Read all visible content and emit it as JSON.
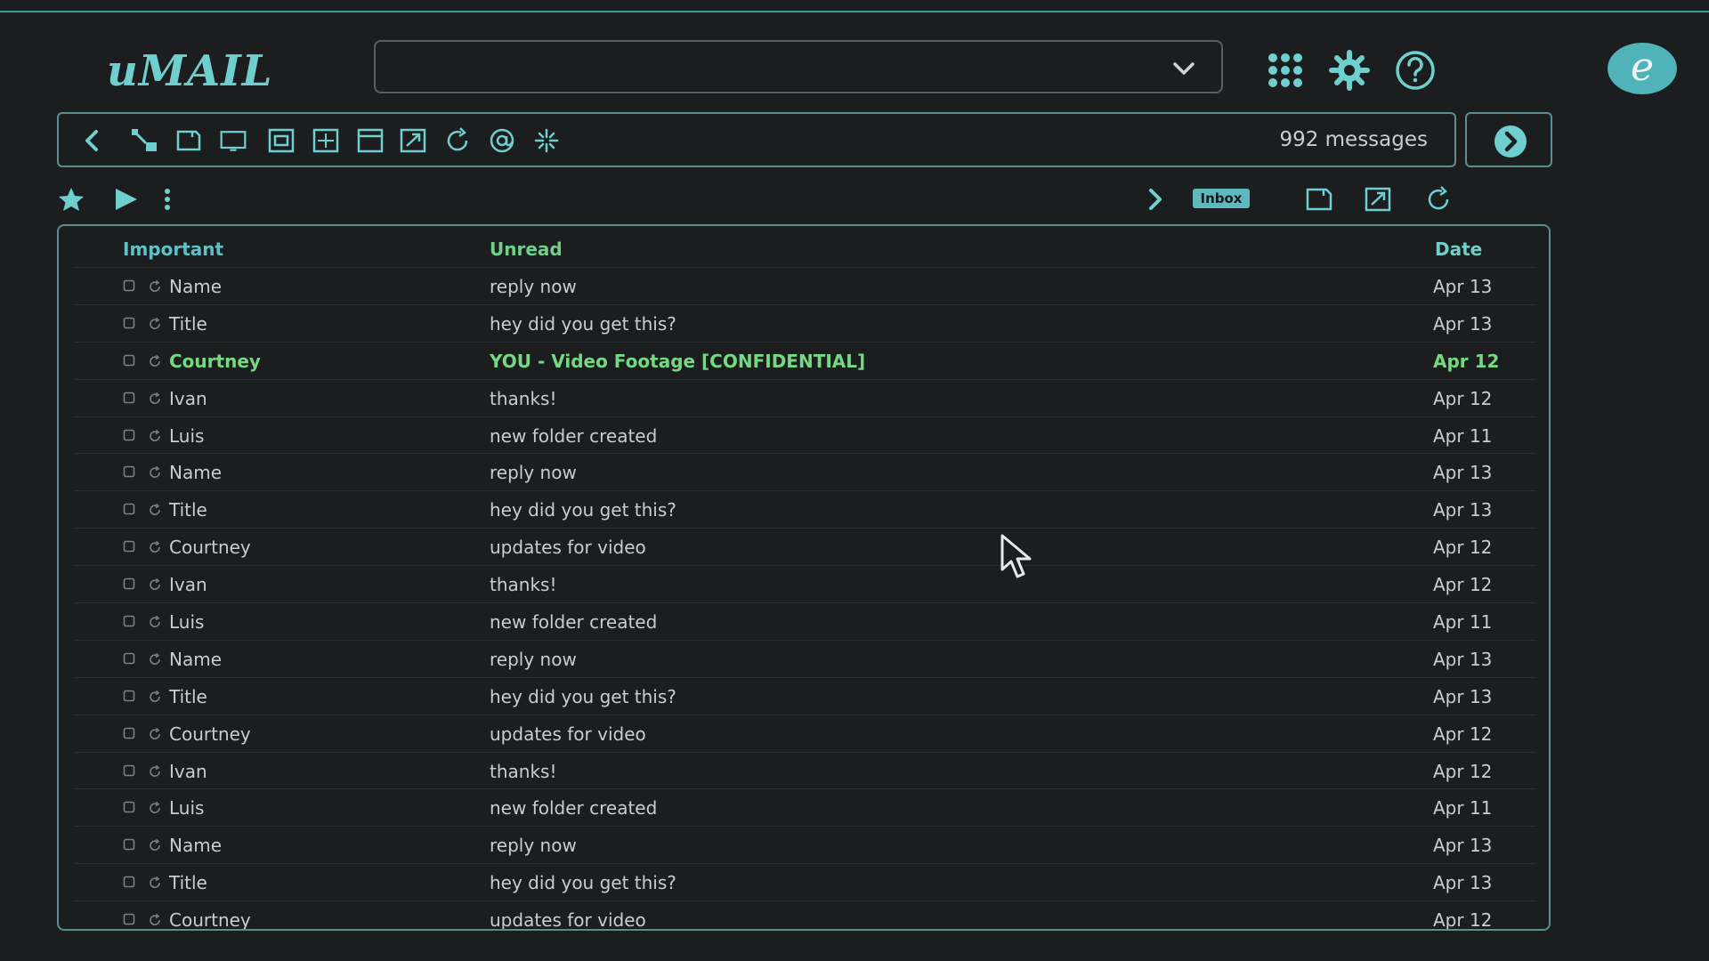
{
  "app": {
    "logo": "uMAIL"
  },
  "colors": {
    "accent": "#5fc0c6",
    "highlight": "#74d982",
    "background": "#1c1d1f"
  },
  "header": {
    "search": {
      "value": "",
      "placeholder": ""
    },
    "icons": [
      "apps-grid-icon",
      "gear-icon",
      "help-icon"
    ],
    "avatar_letter": "e"
  },
  "toolbar": {
    "icons": [
      "back-icon",
      "move-icon",
      "archive-icon",
      "window-icon",
      "frame-icon",
      "grid-icon",
      "layout-icon",
      "open-external-icon",
      "refresh-icon",
      "mention-icon",
      "sparkle-icon"
    ],
    "message_count": "992 messages",
    "next_icon": "chevron-right-circle-icon"
  },
  "subbar": {
    "folder_badge": "Inbox"
  },
  "table": {
    "columns": {
      "important": "Important",
      "unread": "Unread",
      "date": "Date"
    },
    "rows": [
      {
        "sender": "Name",
        "subject": "reply now",
        "date": "Apr 13"
      },
      {
        "sender": "Title",
        "subject": "hey did you get this?",
        "date": "Apr 13"
      },
      {
        "sender": "Courtney",
        "subject": "YOU - Video Footage [CONFIDENTIAL]",
        "date": "Apr 12",
        "highlight": true
      },
      {
        "sender": "Ivan",
        "subject": "thanks!",
        "date": "Apr 12"
      },
      {
        "sender": "Luis",
        "subject": "new folder created",
        "date": "Apr 11"
      },
      {
        "sender": "Name",
        "subject": "reply now",
        "date": "Apr 13"
      },
      {
        "sender": "Title",
        "subject": "hey did you get this?",
        "date": "Apr 13"
      },
      {
        "sender": "Courtney",
        "subject": "updates for video",
        "date": "Apr 12"
      },
      {
        "sender": "Ivan",
        "subject": "thanks!",
        "date": "Apr 12"
      },
      {
        "sender": "Luis",
        "subject": "new folder created",
        "date": "Apr 11"
      },
      {
        "sender": "Name",
        "subject": "reply now",
        "date": "Apr 13"
      },
      {
        "sender": "Title",
        "subject": "hey did you get this?",
        "date": "Apr 13"
      },
      {
        "sender": "Courtney",
        "subject": "updates for video",
        "date": "Apr 12"
      },
      {
        "sender": "Ivan",
        "subject": "thanks!",
        "date": "Apr 12"
      },
      {
        "sender": "Luis",
        "subject": "new folder created",
        "date": "Apr 11"
      },
      {
        "sender": "Name",
        "subject": "reply now",
        "date": "Apr 13"
      },
      {
        "sender": "Title",
        "subject": "hey did you get this?",
        "date": "Apr 13"
      },
      {
        "sender": "Courtney",
        "subject": "updates for video",
        "date": "Apr 12"
      }
    ]
  }
}
